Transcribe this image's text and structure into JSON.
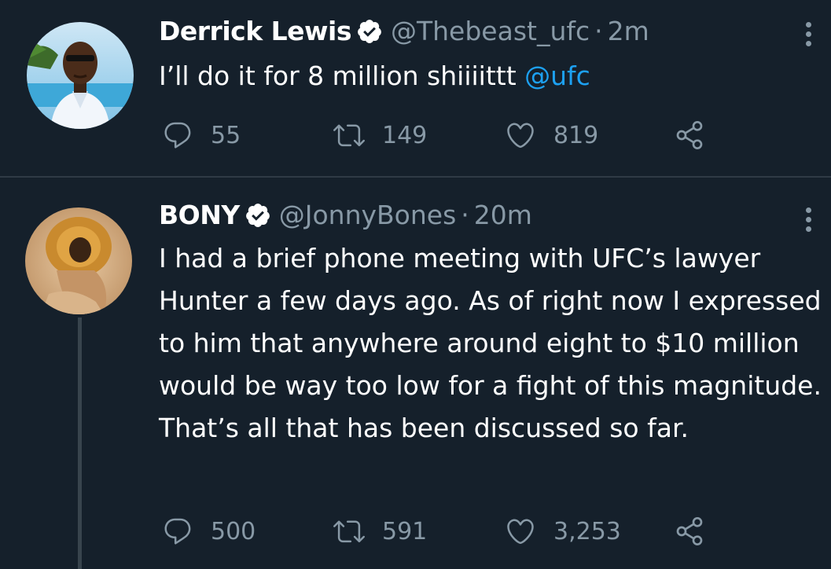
{
  "colors": {
    "background": "#15202b",
    "secondary_text": "#8899a6",
    "link": "#1da1f2",
    "verified_badge": "#ffffff"
  },
  "tweets": [
    {
      "name": "Derrick Lewis",
      "handle": "@Thebeast_ufc",
      "separator": "·",
      "time": "2m",
      "text": "I’ll do it for 8 million shiiiittt ",
      "mention": "@ufc",
      "replies": "55",
      "retweets": "149",
      "likes": "819"
    },
    {
      "name": "BONY",
      "handle": "@JonnyBones",
      "separator": "·",
      "time": "20m",
      "text": "I had a brief phone meeting with UFC’s lawyer Hunter a few days ago. As of right now I expressed to him that anywhere around eight to $10 million would be way too low for a fight of this magnitude. That’s all that has been discussed so far.",
      "replies": "500",
      "retweets": "591",
      "likes": "3,253"
    }
  ],
  "icons": {
    "verified": "verified-badge-icon",
    "more": "more-options-icon",
    "reply": "reply-icon",
    "retweet": "retweet-icon",
    "like": "heart-icon",
    "share": "share-icon"
  }
}
